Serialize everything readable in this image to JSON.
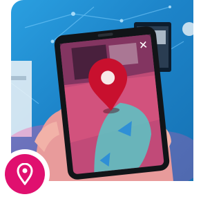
{
  "scene": {
    "subject": "hand holding smartphone showing augmented reality location pin",
    "background_color": "#1d84c9",
    "accent_color": "#e0106f",
    "pin_color": "#c8102e"
  },
  "badge": {
    "icon": "map-pin-icon",
    "background": "#e0106f"
  }
}
